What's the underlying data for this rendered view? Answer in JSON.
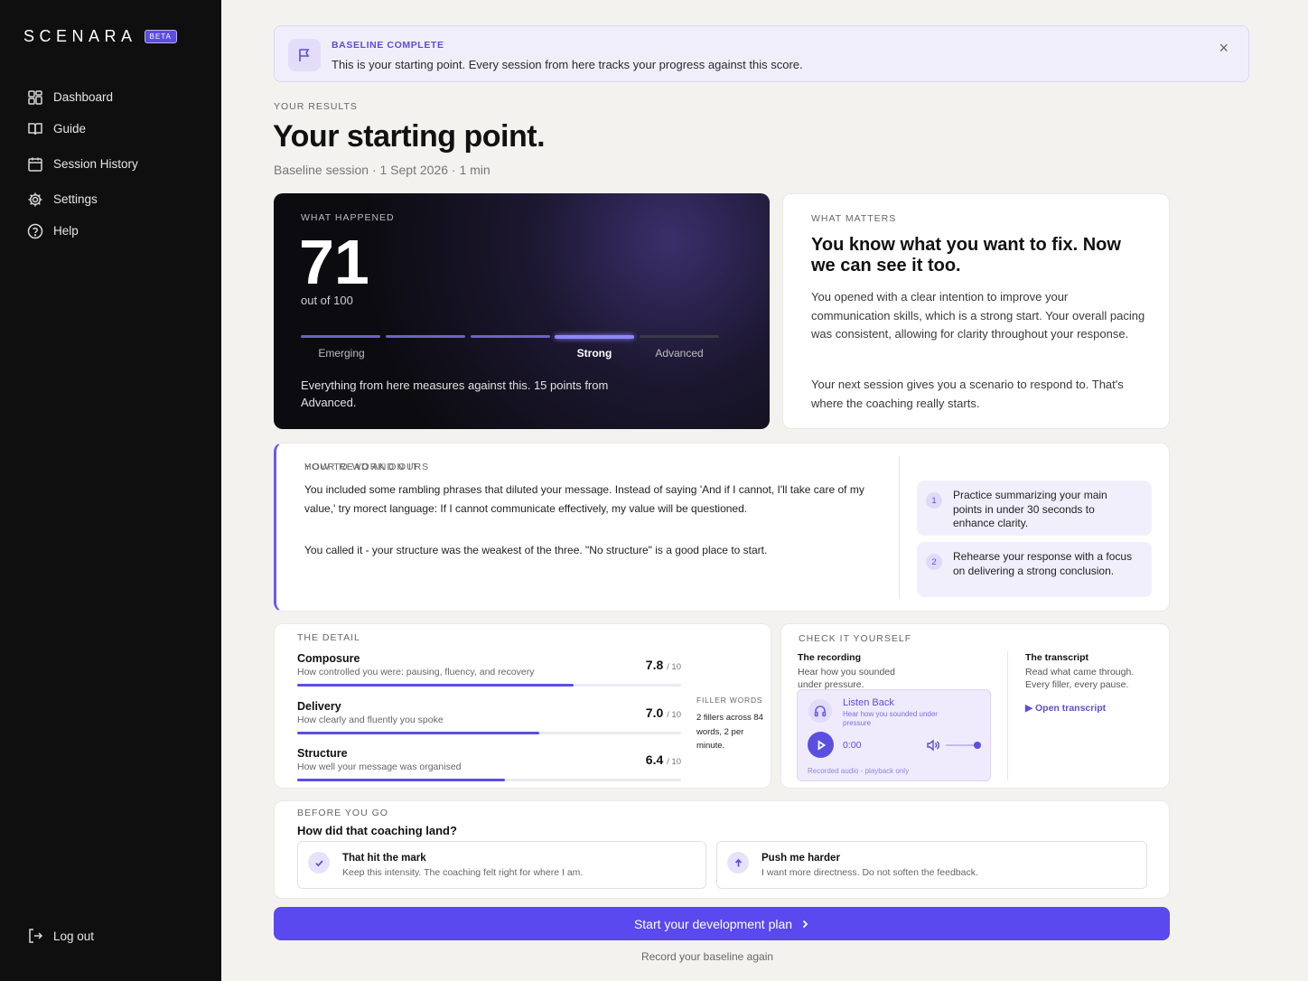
{
  "brand": {
    "name": "SCENARA",
    "badge": "BETA"
  },
  "sidebar": {
    "items": [
      {
        "label": "Dashboard",
        "icon": "dashboard-icon"
      },
      {
        "label": "Guide",
        "icon": "book-icon"
      },
      {
        "label": "Session History",
        "icon": "calendar-icon"
      },
      {
        "label": "Settings",
        "icon": "gear-icon"
      },
      {
        "label": "Help",
        "icon": "help-icon"
      }
    ],
    "logout": "Log out"
  },
  "banner": {
    "title": "BASELINE COMPLETE",
    "text": "This is your starting point. Every session from here tracks your progress against this score.",
    "close": "×"
  },
  "results": {
    "eyebrow": "YOUR RESULTS",
    "title": "Your starting point.",
    "meta": "Baseline session · 1 Sept 2026 · 1 min"
  },
  "score": {
    "eyebrow": "WHAT HAPPENED",
    "value": "71",
    "out_of": "out of 100",
    "levels": [
      "Emerging",
      "Strong",
      "Advanced"
    ],
    "current_level": "Strong",
    "note": "Everything from here measures against this. 15 points from Advanced."
  },
  "matters": {
    "eyebrow": "WHAT MATTERS",
    "title": "You know what you want to fix. Now we can see it too.",
    "p1": "You opened with a clear intention to improve your communication skills, which is a strong start. Your overall pacing was consistent, allowing for clarity throughout your response.",
    "p2": "Your next session gives you a scenario to respond to. That's where the coaching really starts."
  },
  "read_ours": {
    "eyebrow": "YOUR READ AND OURS",
    "p1": "You included some rambling phrases that diluted your message. Instead of saying 'And if I cannot, I'll take care of my value,' try morect language: If I cannot communicate effectively, my value will be questioned.",
    "p2": "You called it - your structure was the weakest of the three. \"No structure\" is a good place to start.",
    "how_eyebrow": "HOW TO WORK ON IT",
    "steps": [
      {
        "num": "1",
        "text": "Practice summarizing your main points in under 30 seconds to enhance clarity."
      },
      {
        "num": "2",
        "text": "Rehearse your response with a focus on delivering a strong conclusion."
      }
    ]
  },
  "detail": {
    "eyebrow": "THE DETAIL",
    "metrics": [
      {
        "name": "Composure",
        "desc": "How controlled you were: pausing, fluency, and recovery",
        "score": "7.8",
        "of": "/ 10",
        "fill": 0.72
      },
      {
        "name": "Delivery",
        "desc": "How clearly and fluently you spoke",
        "score": "7.0",
        "of": "/ 10",
        "fill": 0.63
      },
      {
        "name": "Structure",
        "desc": "How well your message was organised",
        "score": "6.4",
        "of": "/ 10",
        "fill": 0.54
      }
    ],
    "filler_eyebrow": "FILLER WORDS",
    "filler_text": "2 fillers across 84 words, 2 per minute."
  },
  "check": {
    "eyebrow": "CHECK IT YOURSELF",
    "recording_title": "The recording",
    "recording_desc": "Hear how you sounded under pressure.",
    "player_title": "Listen Back",
    "player_desc": "Hear how you sounded under pressure",
    "time": "0:00",
    "volume": 1.0,
    "player_note": "Recorded audio - playback only",
    "transcript_title": "The transcript",
    "transcript_desc": "Read what came through. Every filler, every pause.",
    "transcript_link": "Open transcript"
  },
  "before": {
    "eyebrow": "BEFORE YOU GO",
    "title": "How did that coaching land?",
    "options": [
      {
        "title": "That hit the mark",
        "desc": "Keep this intensity. The coaching felt right for where I am.",
        "icon": "check-icon"
      },
      {
        "title": "Push me harder",
        "desc": "I want more directness. Do not soften the feedback.",
        "icon": "arrow-up-icon"
      }
    ]
  },
  "cta": {
    "label": "Start your development plan",
    "secondary": "Record your baseline again"
  },
  "colors": {
    "accent": "#5a49ee",
    "sidebar": "#0f0f10",
    "background": "#f3f2ef"
  }
}
